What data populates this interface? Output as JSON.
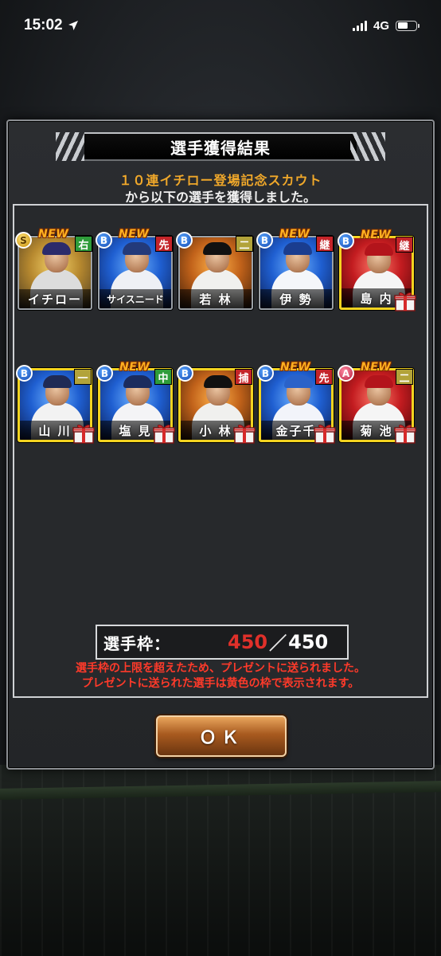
{
  "status_bar": {
    "time": "15:02",
    "network": "4G",
    "battery_level": 0.55
  },
  "dialog": {
    "title": "選手獲得結果",
    "subtitle_line1": "１０連イチロー登場記念スカウト",
    "subtitle_line2": "から以下の選手を獲得しました。",
    "new_label": "NEW",
    "cards": [
      {
        "name": "イチロー",
        "rank": "S",
        "position": "右",
        "pos_color": "green",
        "is_new": true,
        "gift": false,
        "bg": "gold-bg",
        "uniform": "#dcdcdc",
        "cap": "#2b2b6b"
      },
      {
        "name": "サイスニード",
        "rank": "B",
        "position": "先",
        "pos_color": "red",
        "is_new": true,
        "gift": false,
        "bg": "blue-bg",
        "uniform": "#eef0f5",
        "cap": "#233a7a"
      },
      {
        "name": "若 林",
        "rank": "B",
        "position": "二",
        "pos_color": "olive",
        "is_new": false,
        "gift": false,
        "bg": "orange-bg",
        "uniform": "#f0f0ee",
        "cap": "#111111"
      },
      {
        "name": "伊 勢",
        "rank": "B",
        "position": "継",
        "pos_color": "red",
        "is_new": true,
        "gift": false,
        "bg": "blue-bg",
        "uniform": "#f4f6fa",
        "cap": "#1a3d8f"
      },
      {
        "name": "島 内",
        "rank": "B",
        "position": "継",
        "pos_color": "red",
        "is_new": true,
        "gift": true,
        "bg": "red-bg",
        "uniform": "#f5f5f5",
        "cap": "#b3141b"
      },
      {
        "name": "山 川",
        "rank": "B",
        "position": "一",
        "pos_color": "olive",
        "is_new": false,
        "gift": true,
        "bg": "blue-bg",
        "uniform": "#f2f2f2",
        "cap": "#1f2a55"
      },
      {
        "name": "塩 見",
        "rank": "B",
        "position": "中",
        "pos_color": "green",
        "is_new": true,
        "gift": true,
        "bg": "blue-bg",
        "uniform": "#f4f4f6",
        "cap": "#1b2c5e"
      },
      {
        "name": "小 林",
        "rank": "B",
        "position": "捕",
        "pos_color": "red",
        "is_new": false,
        "gift": true,
        "bg": "orange-bg",
        "uniform": "#f0f0ee",
        "cap": "#111111"
      },
      {
        "name": "金子千",
        "rank": "B",
        "position": "先",
        "pos_color": "red",
        "is_new": true,
        "gift": true,
        "bg": "blue-bg",
        "uniform": "#f2f4fa",
        "cap": "#2a62c9"
      },
      {
        "name": "菊 池",
        "rank": "A",
        "position": "二",
        "pos_color": "olive",
        "is_new": true,
        "gift": true,
        "bg": "red-bg",
        "uniform": "#f5f5f5",
        "cap": "#b3141b"
      }
    ],
    "slots": {
      "label": "選手枠：",
      "current": "450",
      "separator": "／",
      "max": "450"
    },
    "warning_line1": "選手枠の上限を超えたため、プレゼントに送られました。",
    "warning_line2": "プレゼントに送られた選手は黄色の枠で表示されます。",
    "ok_label": "ＯＫ"
  }
}
